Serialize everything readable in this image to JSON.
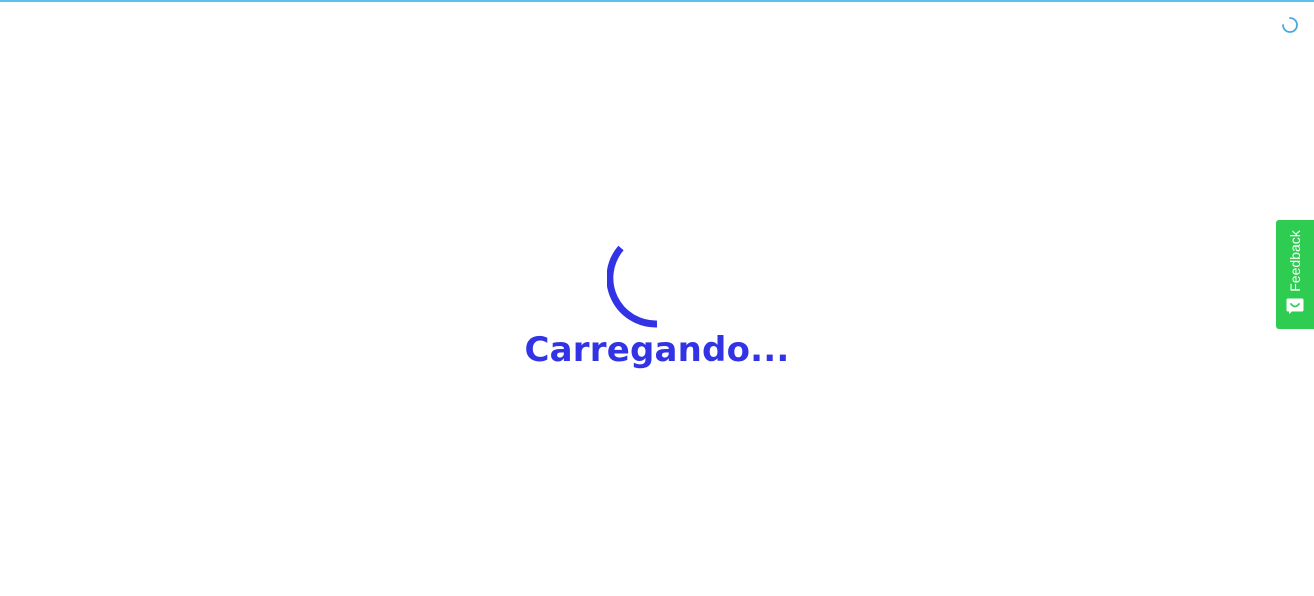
{
  "colors": {
    "progress_bar": "#5bc0eb",
    "corner_spinner": "#4aa8e0",
    "loader": "#3333e6",
    "feedback_tab": "#2ecc50",
    "feedback_text": "#ffffff"
  },
  "loader": {
    "text": "Carregando..."
  },
  "feedback": {
    "label": "Feedback",
    "icon": "smile-chat-icon"
  },
  "icons": {
    "main_spinner": "spinner-icon",
    "corner_spinner": "spinner-icon"
  }
}
